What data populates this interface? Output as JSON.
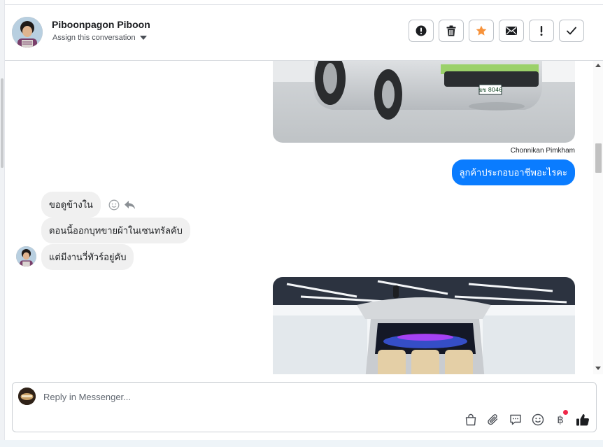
{
  "header": {
    "contact_name": "Piboonpagon Piboon",
    "assign_label": "Assign this conversation",
    "toolbar": [
      {
        "name": "spam-button",
        "icon": "alert-circle-icon"
      },
      {
        "name": "delete-button",
        "icon": "trash-icon"
      },
      {
        "name": "star-button",
        "icon": "star-icon",
        "color": "#f7923a"
      },
      {
        "name": "mark-unread-button",
        "icon": "envelope-icon"
      },
      {
        "name": "follow-up-button",
        "icon": "exclamation-icon"
      },
      {
        "name": "done-button",
        "icon": "checkmark-icon"
      }
    ]
  },
  "thread": {
    "outgoing_sender": "Chonnikan Pimkham",
    "outgoing_message": "ลูกค้าประกอบอาชีพอะไรคะ",
    "incoming_messages": [
      "ขอดูข้างใน",
      "ตอนนี้ออกบุทขายผ้าในเซนทรัลคับ",
      "แต่มีงานวี่ทัวร์อยู่คับ"
    ],
    "photo_top_plate": "ฆข 8046"
  },
  "composer": {
    "placeholder": "Reply in Messenger...",
    "value": "",
    "tools": [
      "shopping-bag-icon",
      "paperclip-icon",
      "saved-reply-icon",
      "emoji-icon",
      "baht-payment-icon",
      "thumbs-up-icon"
    ],
    "baht_symbol": "฿"
  },
  "colors": {
    "accent": "#0a7cff",
    "incoming_bubble": "#f0f0f0",
    "star": "#f7923a",
    "notification_dot": "#f02849",
    "like": "#1c1e21"
  }
}
